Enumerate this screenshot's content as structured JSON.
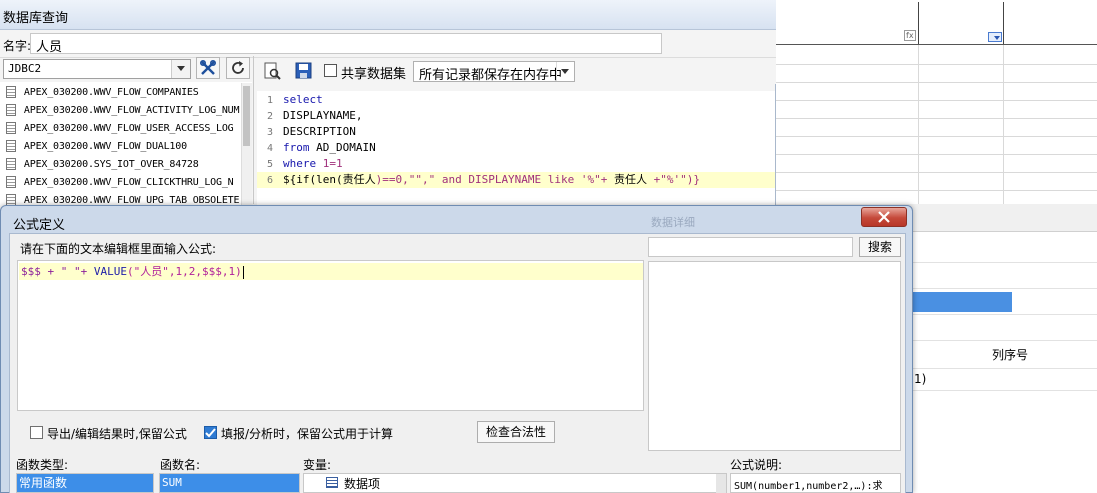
{
  "db_window": {
    "title": "数据库查询",
    "title_visible": "数据库查询",
    "name_label": "名字:",
    "name_label_visible": "名字:",
    "name_value": "人员",
    "connection": "JDBC2",
    "share_label": "共享数据集",
    "memory_option": "所有记录都保存在内存中",
    "tables": [
      "APEX_030200.WWV_FLOW_COMPANIES",
      "APEX_030200.WWV_FLOW_ACTIVITY_LOG_NUM",
      "APEX_030200.WWV_FLOW_USER_ACCESS_LOG",
      "APEX_030200.WWV_FLOW_DUAL100",
      "APEX_030200.SYS_IOT_OVER_84728",
      "APEX_030200.WWV_FLOW_CLICKTHRU_LOG_N",
      "APEX_030200.WWV_FLOW_UPG_TAB_OBSOLETE"
    ],
    "sql_line_numbers": [
      "1",
      "2",
      "3",
      "4",
      "5",
      "6"
    ],
    "sql": {
      "l1": "select",
      "l2": "DISPLAYNAME,",
      "l3": "DESCRIPTION",
      "l4_kw": "from",
      "l4_rest": " AD_DOMAIN",
      "l5_kw": "where",
      "l5_rest": " 1=1",
      "l6_a": "${if(len(",
      "l6_b": "责任人",
      "l6_c": ")==0,\"\",\" and DISPLAYNAME like '%\"+ ",
      "l6_d": "责任人",
      "l6_e": " +\"%'\")}"
    }
  },
  "background": {
    "fx_mark": "fx",
    "column_order_label": "列序号",
    "paren_tail": "1)"
  },
  "formula_dialog": {
    "title": "公式定义",
    "ghost_title": "数据详细",
    "prompt": "请在下面的文本编辑框里面输入公式:",
    "formula": {
      "p1": "$$$ + \" \"+ ",
      "p2": "VALUE",
      "p3": "(\"人员\",1,2,$$$,1)"
    },
    "search_label": "搜索",
    "keep_export_label": "导出/编辑结果时,保留公式",
    "keep_export_checked": false,
    "keep_fill_label": "填报/分析时，保留公式用于计算",
    "keep_fill_checked": true,
    "check_button": "检查合法性",
    "function_type_label": "函数类型:",
    "function_name_label": "函数名:",
    "variable_label": "变量:",
    "description_label": "公式说明:",
    "selected_function_type": "常用函数",
    "selected_function_name": "SUM",
    "variable_node": "数据项",
    "description_text": "SUM(number1,number2,…):求"
  },
  "colors": {
    "selection_blue": "#3d8ee8",
    "highlight_yellow": "#ffffcc",
    "keyword_blue": "#1717ad",
    "string_magenta": "#a0307b",
    "close_red": "#c5493a"
  }
}
